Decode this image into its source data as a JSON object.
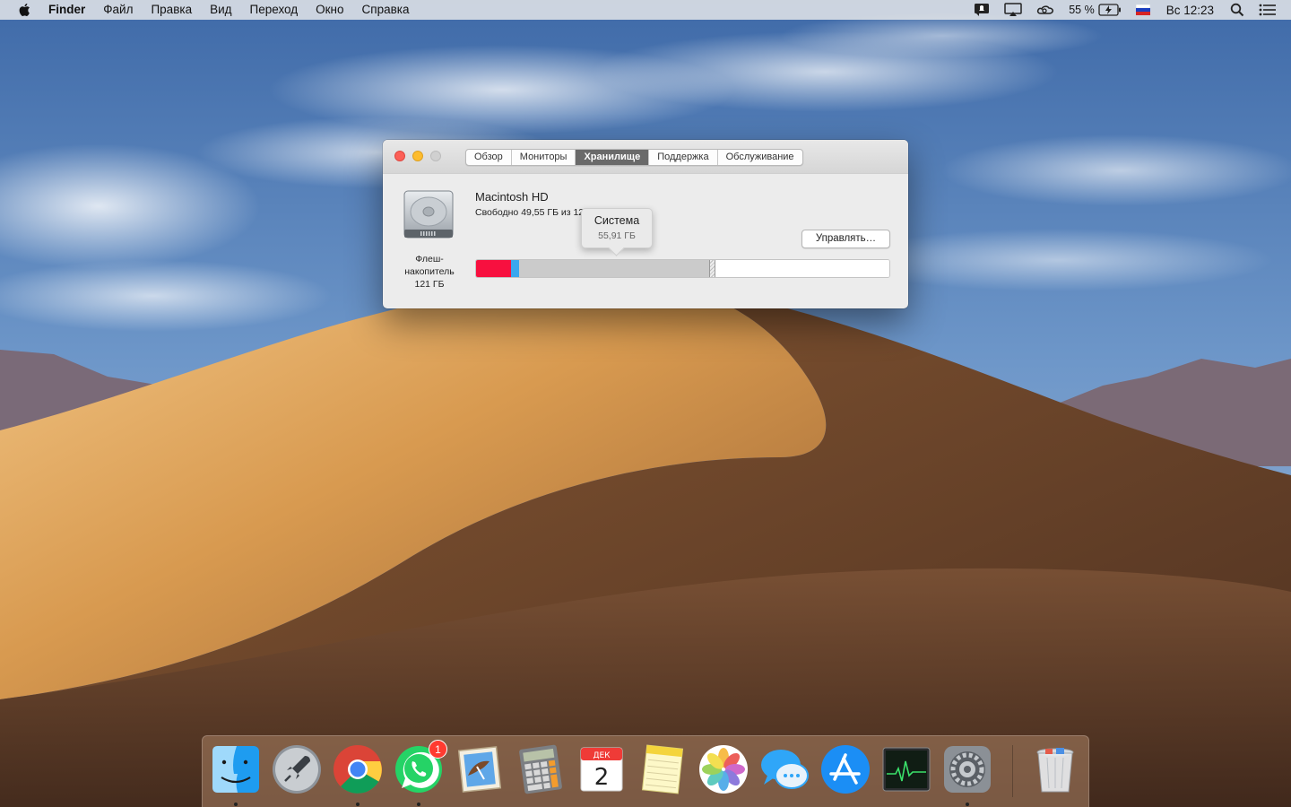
{
  "menubar": {
    "app_name": "Finder",
    "items": [
      "Файл",
      "Правка",
      "Вид",
      "Переход",
      "Окно",
      "Справка"
    ],
    "battery": "55 %",
    "clock": "Вс 12:23",
    "status_icons": [
      "notification-icon",
      "airplay-icon",
      "creative-cloud-icon",
      "battery-icon",
      "flag-ru-icon",
      "spotlight-icon",
      "notification-center-icon"
    ]
  },
  "window": {
    "tabs": [
      {
        "label": "Обзор",
        "active": false
      },
      {
        "label": "Мониторы",
        "active": false
      },
      {
        "label": "Хранилище",
        "active": true
      },
      {
        "label": "Поддержка",
        "active": false
      },
      {
        "label": "Обслуживание",
        "active": false
      }
    ],
    "disk": {
      "label_line1": "Флеш-",
      "label_line2": "накопитель",
      "label_line3": "121 ГБ",
      "name": "Macintosh HD",
      "free": "Свободно 49,55 ГБ из 121,"
    },
    "manage_button": "Управлять…",
    "tooltip": {
      "title": "Система",
      "value": "55,91 ГБ"
    },
    "storage_bar": {
      "apps_fraction": 0.085,
      "docs_fraction": 0.019,
      "system_fraction": 0.46,
      "other_fraction": 0.016,
      "free_fraction": 0.42,
      "colors": {
        "apps": "#f7103f",
        "docs": "#3aa7ef",
        "system": "#cbcbcb",
        "free": "#ffffff"
      }
    }
  },
  "dock": {
    "apps": [
      {
        "name": "Finder",
        "icon": "finder-icon",
        "running": true
      },
      {
        "name": "Launchpad",
        "icon": "launchpad-icon",
        "running": false
      },
      {
        "name": "Google Chrome",
        "icon": "chrome-icon",
        "running": true
      },
      {
        "name": "WhatsApp",
        "icon": "whatsapp-icon",
        "running": true,
        "badge": "1"
      },
      {
        "name": "Mail",
        "icon": "mail-icon",
        "running": false
      },
      {
        "name": "Calculator",
        "icon": "calculator-icon",
        "running": false
      },
      {
        "name": "Calendar",
        "icon": "calendar-icon",
        "running": false,
        "month": "ДЕК",
        "day": "2"
      },
      {
        "name": "Notes",
        "icon": "notes-icon",
        "running": false
      },
      {
        "name": "Photos",
        "icon": "photos-icon",
        "running": false
      },
      {
        "name": "Messages",
        "icon": "messages-icon",
        "running": false
      },
      {
        "name": "App Store",
        "icon": "appstore-icon",
        "running": false
      },
      {
        "name": "Activity Monitor",
        "icon": "activity-monitor-icon",
        "running": false
      },
      {
        "name": "System Preferences",
        "icon": "system-preferences-icon",
        "running": true
      }
    ],
    "trash": {
      "name": "Trash",
      "icon": "trash-icon"
    }
  }
}
